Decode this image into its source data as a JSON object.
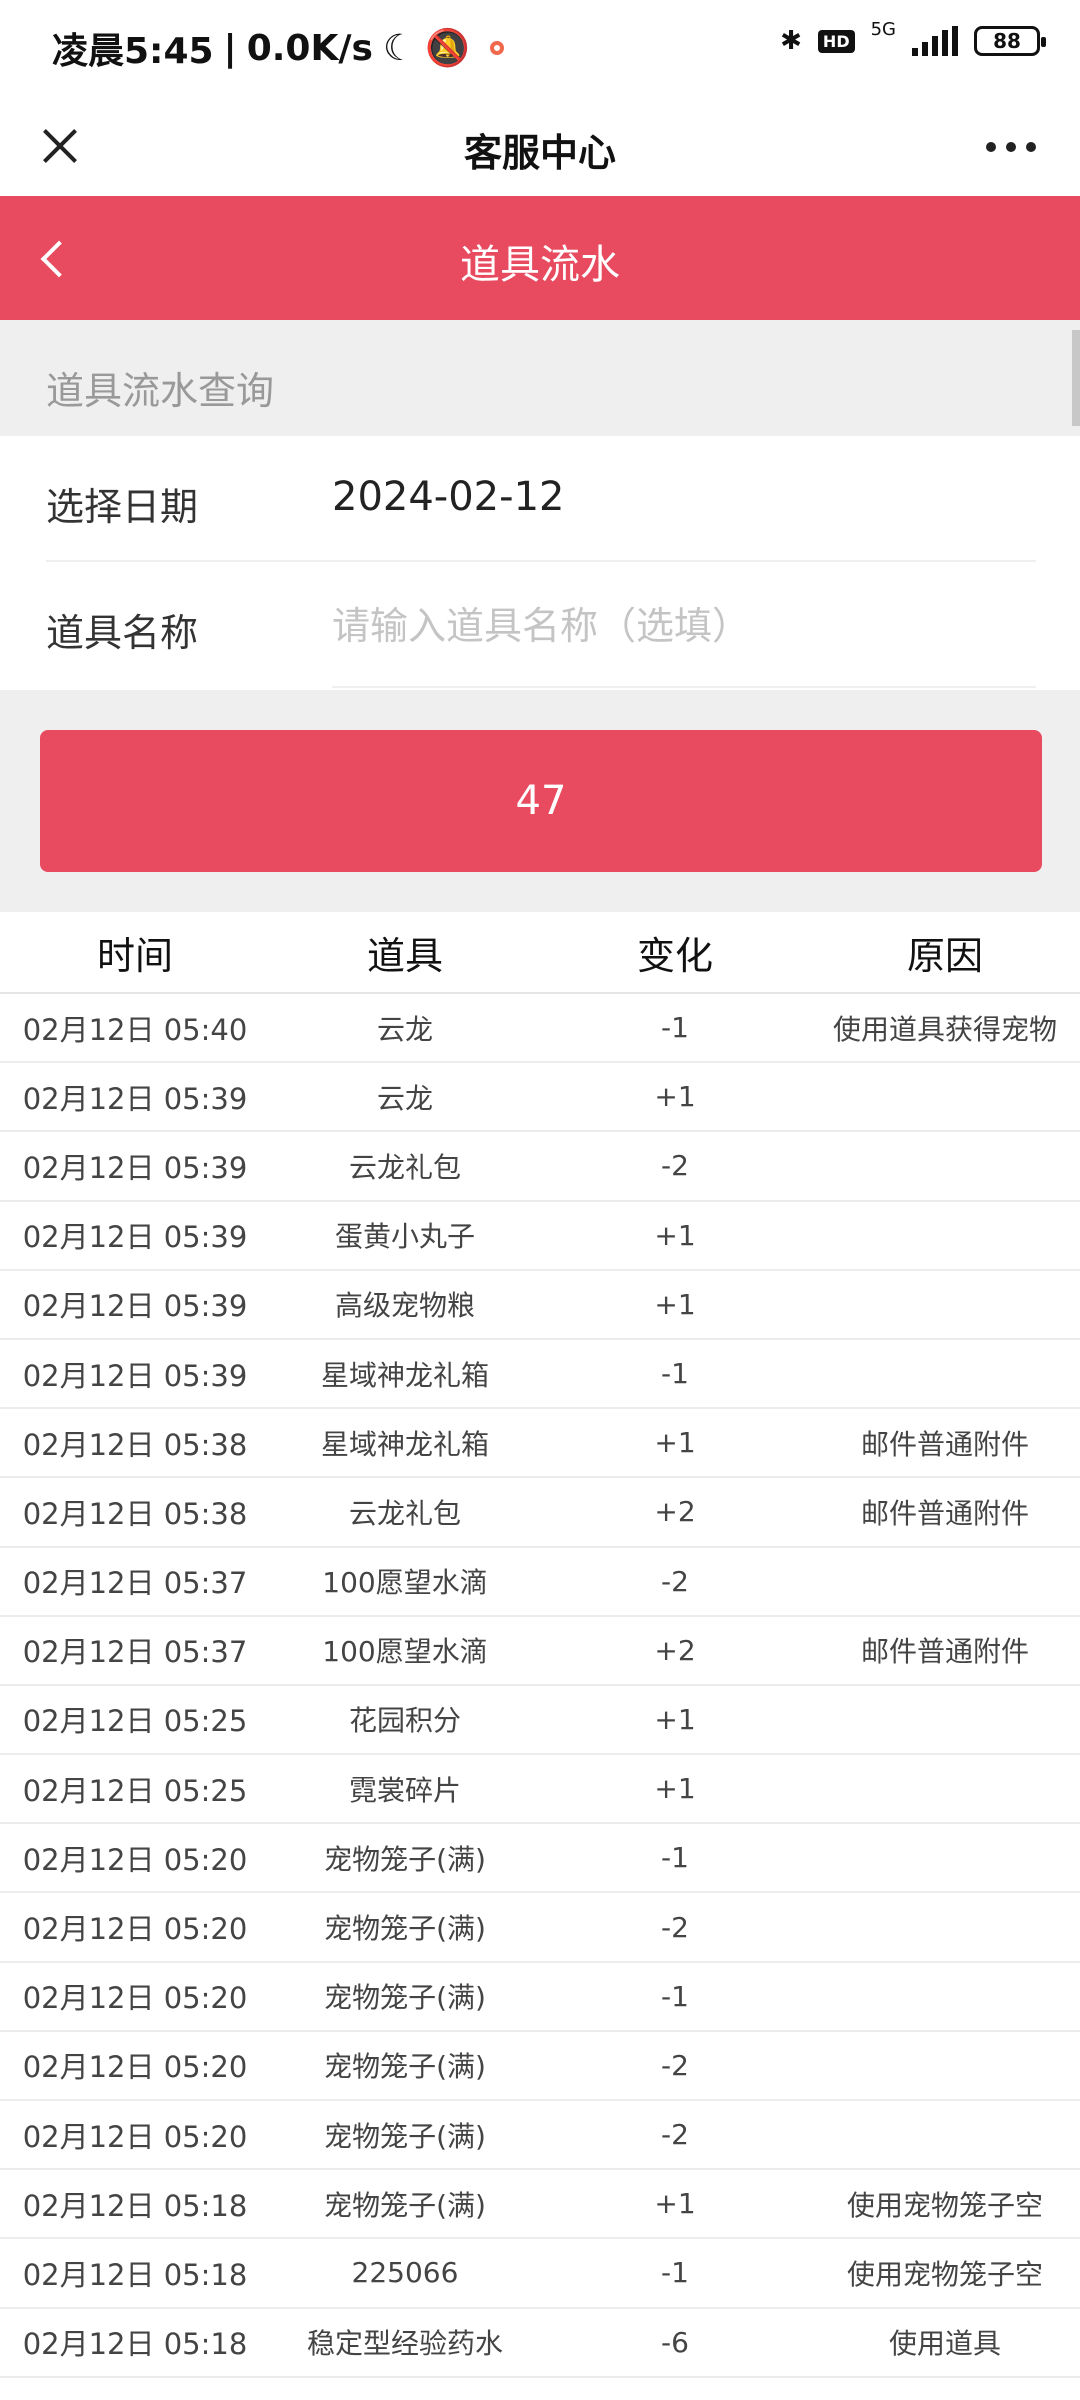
{
  "status_bar": {
    "time": "凌晨5:45",
    "network_speed": "0.0K/s",
    "hd": "HD",
    "net_type": "5G",
    "battery": "88"
  },
  "wechat_bar": {
    "title": "客服中心"
  },
  "page_header": {
    "title": "道具流水"
  },
  "query_section": {
    "label": "道具流水查询",
    "date_label": "选择日期",
    "date_value": "2024-02-12",
    "item_label": "道具名称",
    "item_placeholder": "请输入道具名称（选填）",
    "button_label": "47"
  },
  "table": {
    "headers": [
      "时间",
      "道具",
      "变化",
      "原因"
    ],
    "rows": [
      {
        "time": "02月12日 05:40",
        "item": "云龙",
        "change": "-1",
        "reason": "使用道具获得宠物"
      },
      {
        "time": "02月12日 05:39",
        "item": "云龙",
        "change": "+1",
        "reason": ""
      },
      {
        "time": "02月12日 05:39",
        "item": "云龙礼包",
        "change": "-2",
        "reason": ""
      },
      {
        "time": "02月12日 05:39",
        "item": "蛋黄小丸子",
        "change": "+1",
        "reason": ""
      },
      {
        "time": "02月12日 05:39",
        "item": "高级宠物粮",
        "change": "+1",
        "reason": ""
      },
      {
        "time": "02月12日 05:39",
        "item": "星域神龙礼箱",
        "change": "-1",
        "reason": ""
      },
      {
        "time": "02月12日 05:38",
        "item": "星域神龙礼箱",
        "change": "+1",
        "reason": "邮件普通附件"
      },
      {
        "time": "02月12日 05:38",
        "item": "云龙礼包",
        "change": "+2",
        "reason": "邮件普通附件"
      },
      {
        "time": "02月12日 05:37",
        "item": "100愿望水滴",
        "change": "-2",
        "reason": ""
      },
      {
        "time": "02月12日 05:37",
        "item": "100愿望水滴",
        "change": "+2",
        "reason": "邮件普通附件"
      },
      {
        "time": "02月12日 05:25",
        "item": "花园积分",
        "change": "+1",
        "reason": ""
      },
      {
        "time": "02月12日 05:25",
        "item": "霓裳碎片",
        "change": "+1",
        "reason": ""
      },
      {
        "time": "02月12日 05:20",
        "item": "宠物笼子(满)",
        "change": "-1",
        "reason": ""
      },
      {
        "time": "02月12日 05:20",
        "item": "宠物笼子(满)",
        "change": "-2",
        "reason": ""
      },
      {
        "time": "02月12日 05:20",
        "item": "宠物笼子(满)",
        "change": "-1",
        "reason": ""
      },
      {
        "time": "02月12日 05:20",
        "item": "宠物笼子(满)",
        "change": "-2",
        "reason": ""
      },
      {
        "time": "02月12日 05:20",
        "item": "宠物笼子(满)",
        "change": "-2",
        "reason": ""
      },
      {
        "time": "02月12日 05:18",
        "item": "宠物笼子(满)",
        "change": "+1",
        "reason": "使用宠物笼子空"
      },
      {
        "time": "02月12日 05:18",
        "item": "225066",
        "change": "-1",
        "reason": "使用宠物笼子空"
      },
      {
        "time": "02月12日 05:18",
        "item": "稳定型经验药水",
        "change": "-6",
        "reason": "使用道具"
      }
    ]
  }
}
